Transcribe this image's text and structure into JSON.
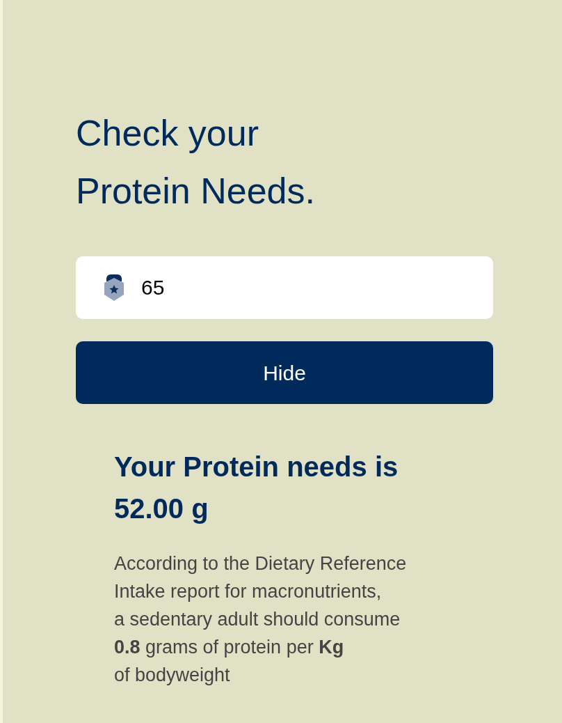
{
  "title": "Check your\nProtein Needs.",
  "weight_field": {
    "value": "65"
  },
  "toggle_button": {
    "label": "Hide"
  },
  "result": {
    "visible": true,
    "heading": "Your Protein needs is\n52.00 g",
    "explanation": "According to the Dietary Reference\nIntake report for macronutrients,\na sedentary adult should consume\n**0.8** grams of protein per **Kg**\nof bodyweight"
  }
}
